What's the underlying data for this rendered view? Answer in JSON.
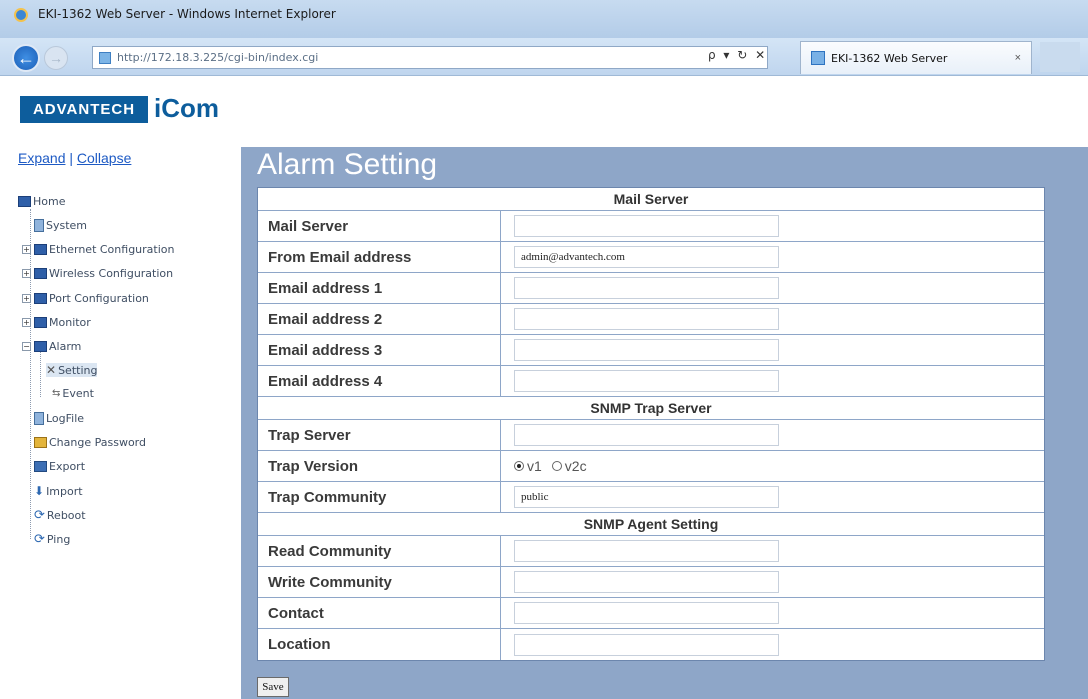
{
  "window": {
    "title": "EKI-1362 Web Server - Windows Internet Explorer"
  },
  "browser": {
    "url": "http://172.18.3.225/cgi-bin/index.cgi",
    "address_controls": "ρ ▾ ↻ ✕",
    "tab_label": "EKI-1362 Web Server",
    "tab_close": "×"
  },
  "brand": {
    "logo_primary": "ADVANTECH",
    "logo_secondary": "iCom"
  },
  "sidebar": {
    "expand": "Expand",
    "separator": "|",
    "collapse": "Collapse",
    "items": [
      {
        "label": "Home"
      },
      {
        "label": "System"
      },
      {
        "label": "Ethernet Configuration"
      },
      {
        "label": "Wireless Configuration"
      },
      {
        "label": "Port Configuration"
      },
      {
        "label": "Monitor"
      },
      {
        "label": "Alarm"
      },
      {
        "label": "Setting"
      },
      {
        "label": "Event"
      },
      {
        "label": "LogFile"
      },
      {
        "label": "Change Password"
      },
      {
        "label": "Export"
      },
      {
        "label": "Import"
      },
      {
        "label": "Reboot"
      },
      {
        "label": "Ping"
      }
    ]
  },
  "page": {
    "title": "Alarm Setting"
  },
  "form": {
    "sections": {
      "mail": "Mail Server",
      "trap": "SNMP Trap Server",
      "agent": "SNMP Agent Setting"
    },
    "labels": {
      "mail_server": "Mail Server",
      "from_email": "From Email address",
      "email1": "Email address 1",
      "email2": "Email address 2",
      "email3": "Email address 3",
      "email4": "Email address 4",
      "trap_server": "Trap Server",
      "trap_version": "Trap Version",
      "trap_community": "Trap Community",
      "read_community": "Read Community",
      "write_community": "Write Community",
      "contact": "Contact",
      "location": "Location"
    },
    "values": {
      "mail_server": "",
      "from_email": "admin@advantech.com",
      "email1": "",
      "email2": "",
      "email3": "",
      "email4": "",
      "trap_server": "",
      "trap_version_options": [
        "v1",
        "v2c"
      ],
      "trap_version_selected": "v1",
      "trap_community": "public",
      "read_community": "",
      "write_community": "",
      "contact": "",
      "location": ""
    },
    "save_label": "Save"
  }
}
